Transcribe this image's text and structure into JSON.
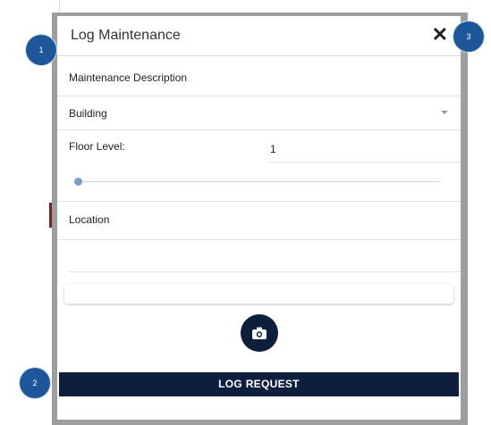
{
  "modal": {
    "title": "Log Maintenance",
    "close_glyph": "✕",
    "description_label": "Maintenance Description",
    "building_label": "Building",
    "floor_label": "Floor Level:",
    "floor_value": "1",
    "floor_slider_level": 0,
    "location_label": "Location",
    "submit_label": "LOG REQUEST"
  },
  "badges": [
    "1",
    "2",
    "3"
  ],
  "icons": {
    "close": "close-icon",
    "dropdown": "chevron-down-icon",
    "camera": "camera-icon"
  },
  "colors": {
    "primary": "#0e1f3e",
    "badge": "#1e5799",
    "slider": "#7f9cc7"
  }
}
